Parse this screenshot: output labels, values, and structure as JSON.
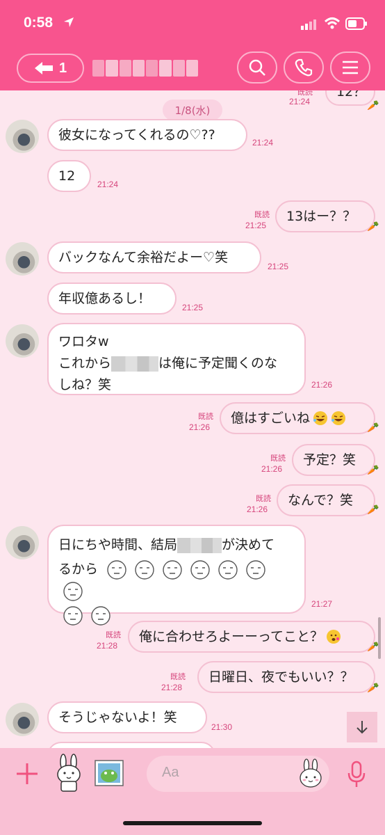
{
  "status_bar": {
    "time": "0:58"
  },
  "header": {
    "back_count": "1"
  },
  "chat": {
    "date": "1/8(水)",
    "read_label": "既読",
    "top_partial": {
      "text": "12？",
      "time": "21:24"
    },
    "messages": [
      {
        "text": "彼女になってくれるの♡??",
        "time": "21:24"
      },
      {
        "text": "12",
        "time": "21:24"
      },
      {
        "text": "13はー？？",
        "time": "21:25"
      },
      {
        "text": "バックなんて余裕だよー♡笑",
        "time": "21:25"
      },
      {
        "text": "年収億あるし！",
        "time": "21:25"
      },
      {
        "line1": "ワロタw",
        "line2_before": "これから",
        "line2_after": "は俺に予定聞くのな",
        "line3": "しね？笑",
        "time": "21:26"
      },
      {
        "text": "億はすごいね",
        "time": "21:26"
      },
      {
        "text": "予定？笑",
        "time": "21:26"
      },
      {
        "text": "なんで？笑",
        "time": "21:26"
      },
      {
        "line1_before": "日にちや時間、結局",
        "line1_after": "が決めて",
        "line2": "るから",
        "time": "21:27"
      },
      {
        "text": "俺に合わせろよーーってこと？",
        "time": "21:28"
      },
      {
        "text": "日曜日、夜でもいい？？",
        "time": "21:28"
      },
      {
        "text": "そうじゃないよ！笑",
        "time": "21:30"
      }
    ]
  },
  "input": {
    "placeholder": "Aa"
  },
  "colors": {
    "header": "#f8548e",
    "background": "#fde6ee",
    "accent": "#d6457c"
  },
  "icons": [
    "location-arrow-icon",
    "signal-icon",
    "wifi-icon",
    "battery-icon",
    "back-arrow-icon",
    "search-icon",
    "phone-icon",
    "menu-icon",
    "carrot-icon",
    "scroll-down-icon",
    "plus-icon",
    "sticker-icon",
    "photo-icon",
    "emoji-icon",
    "microphone-icon"
  ]
}
